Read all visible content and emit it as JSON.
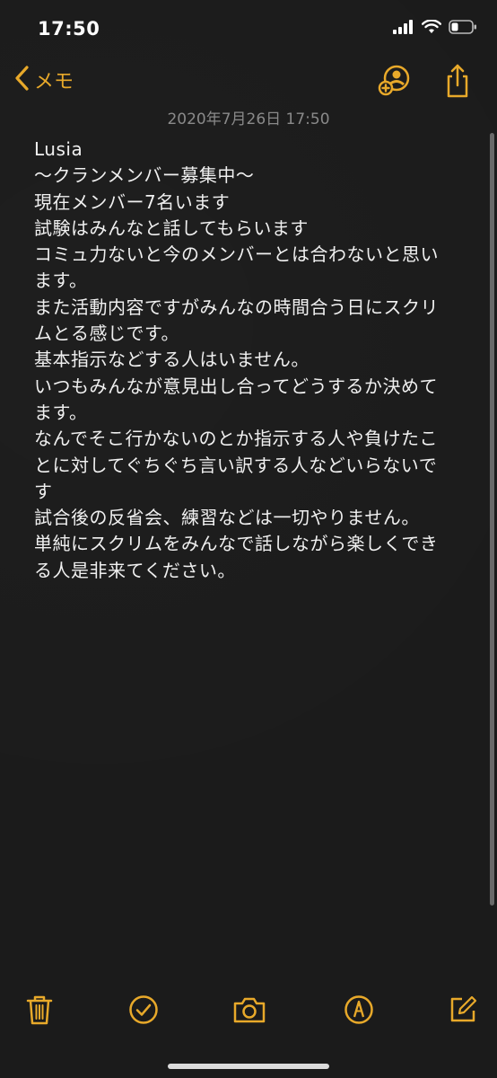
{
  "status_bar": {
    "time": "17:50",
    "icons": [
      "cellular-signal-icon",
      "wifi-icon",
      "battery-icon"
    ]
  },
  "nav": {
    "back_label": "メモ",
    "icons": [
      "chevron-left-icon",
      "add-person-icon",
      "share-icon"
    ]
  },
  "note": {
    "date": "2020年7月26日 17:50",
    "lines": [
      "Lusia",
      "〜クランメンバー募集中〜",
      "現在メンバー7名います",
      "試験はみんなと話してもらいます",
      "コミュ力ないと今のメンバーとは合わないと思い",
      "ます。",
      "また活動内容ですがみんなの時間合う日にスクリ",
      "ムとる感じです。",
      "基本指示などする人はいません。",
      "いつもみんなが意見出し合ってどうするか決めて",
      "ます。",
      "なんでそこ行かないのとか指示する人や負けたこ",
      "とに対してぐちぐち言い訳する人などいらないで",
      "す",
      "試合後の反省会、練習などは一切やりません。",
      "単純にスクリムをみんなで話しながら楽しくでき",
      "る人是非来てください。"
    ]
  },
  "toolbar": {
    "icons": [
      "trash-icon",
      "checklist-icon",
      "camera-icon",
      "markup-icon",
      "compose-icon"
    ]
  },
  "colors": {
    "accent": "#e8a92a",
    "background": "#1b1b1b",
    "text": "#f0f0f0",
    "date_text": "#8a8a8a"
  }
}
